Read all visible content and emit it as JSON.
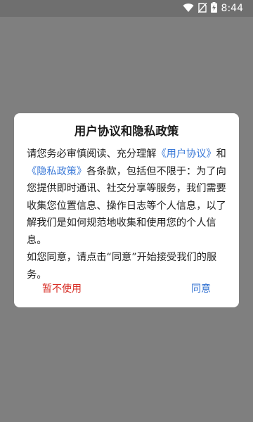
{
  "status_bar": {
    "time": "8:44",
    "icons": [
      "wifi-icon",
      "no-sim-icon",
      "battery-charging-icon"
    ]
  },
  "dialog": {
    "title": "用户协议和隐私政策",
    "body": {
      "intro": "请您务必审慎阅读、充分理解",
      "link_user_agreement": "《用户协议》",
      "and": "和",
      "link_privacy_policy": "《隐私政策》",
      "text_after": "各条款，包括但不限于：为了向您提供即时通讯、社交分享等服务，我们需要收集您位置信息、操作日志等个人信息，以了解我们是如何规范地收集和使用您的个人信息。",
      "agree_note": "如您同意，请点击“同意”开始接受我们的服务。"
    },
    "decline_label": "暂不使用",
    "agree_label": "同意"
  },
  "colors": {
    "overlay": "#7f7f7f",
    "link": "#3d7bd8",
    "decline": "#d83028",
    "agree": "#2f6fd0"
  }
}
